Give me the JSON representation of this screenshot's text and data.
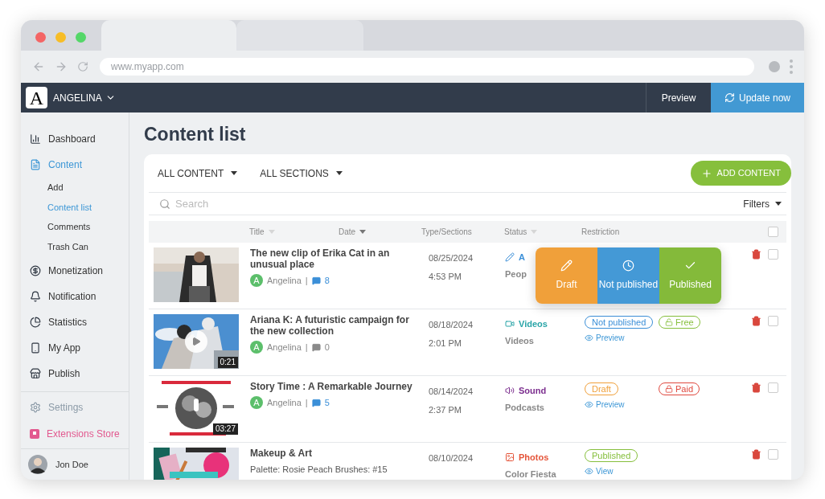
{
  "browser": {
    "address": "www.myapp.com"
  },
  "header": {
    "logo": "A",
    "brand": "ANGELINA",
    "preview": "Preview",
    "update": "Update now"
  },
  "sidebar": {
    "items": [
      {
        "label": "Dashboard",
        "selected": false
      },
      {
        "label": "Content",
        "selected": true,
        "children": [
          {
            "label": "Add",
            "selected": false
          },
          {
            "label": "Content list",
            "selected": true
          },
          {
            "label": "Comments",
            "selected": false
          },
          {
            "label": "Trash Can",
            "selected": false
          }
        ]
      },
      {
        "label": "Monetization",
        "selected": false
      },
      {
        "label": "Notification",
        "selected": false
      },
      {
        "label": "Statistics",
        "selected": false
      },
      {
        "label": "My App",
        "selected": false
      },
      {
        "label": "Publish",
        "selected": false
      }
    ],
    "extras": [
      {
        "label": "Settings",
        "color": "#8b9aa7"
      },
      {
        "label": "Extensions Store",
        "color": "#e2598f"
      }
    ],
    "user": {
      "name": "Jon Doe"
    }
  },
  "page": {
    "title": "Content list"
  },
  "toolbar": {
    "filters": [
      "ALL CONTENT",
      "ALL SECTIONS"
    ],
    "add": "ADD CONTENT",
    "search": {
      "placeholder": "Search"
    },
    "filters_button": "Filters"
  },
  "table": {
    "columns": [
      {
        "label": "Title",
        "sort_active": false
      },
      {
        "label": "Date",
        "sort_active": true
      },
      {
        "label": "Type/Sections"
      },
      {
        "label": "Status",
        "sort_active": false
      },
      {
        "label": "Restriction"
      }
    ],
    "select_all": {
      "checked": false
    },
    "rows": [
      {
        "play": false,
        "title": "The new clip of Erika Cat in an unusual place",
        "author": "Angelina",
        "avatar": "A",
        "separator": "|",
        "comments": {
          "count": "8",
          "color": "#3b8fd8"
        },
        "date": "08/25/2024",
        "time": "4:53 PM",
        "type": {
          "kind": "article",
          "label": "A",
          "color": "#3b8fd8"
        },
        "section": "Peop",
        "checked": false
      },
      {
        "play": true,
        "duration": "0:21",
        "title": "Ariana K: A futuristic campaign for the new collection",
        "author": "Angelina",
        "avatar": "A",
        "separator": "|",
        "comments": {
          "count": "0",
          "color": "#8a8a8a"
        },
        "date": "08/18/2024",
        "time": "2:01 PM",
        "type": {
          "kind": "video",
          "label": "Videos",
          "color": "#2aa5a8"
        },
        "section": "Videos",
        "status": {
          "label": "Not published",
          "color": "#3b8fd8"
        },
        "link": "Preview",
        "restriction": {
          "label": "Free",
          "locked": false,
          "color": "#86bf3c"
        },
        "checked": false
      },
      {
        "play": false,
        "duration": "03:27",
        "title": "Story Time : A Remarkable Journey",
        "author": "Angelina",
        "avatar": "A",
        "separator": "|",
        "comments": {
          "count": "5",
          "color": "#3b8fd8"
        },
        "date": "08/14/2024",
        "time": "2:37 PM",
        "type": {
          "kind": "sound",
          "label": "Sound",
          "color": "#7b2d8e"
        },
        "section": "Podcasts",
        "status": {
          "label": "Draft",
          "color": "#f0a03a"
        },
        "link": "Preview",
        "restriction": {
          "label": "Paid",
          "locked": true,
          "color": "#e0483e"
        },
        "checked": false
      },
      {
        "play": false,
        "title": "Makeup & Art",
        "subtitle": "Palette: Rosie Peach Brushes: #15",
        "date": "08/10/2024",
        "type": {
          "label": "Photos",
          "color": "#e5553a"
        },
        "section": "Color Fiesta",
        "status": {
          "label": "Published",
          "color": "#86bf3c"
        },
        "link": "View",
        "checked": false
      }
    ],
    "status_menu": [
      {
        "kind": "draft",
        "label": "Draft",
        "color": "#f0a03a"
      },
      {
        "kind": "scheduled",
        "label": "Not published",
        "color": "#4499d6"
      },
      {
        "kind": "published",
        "label": "Published",
        "color": "#84ba3a"
      }
    ]
  }
}
